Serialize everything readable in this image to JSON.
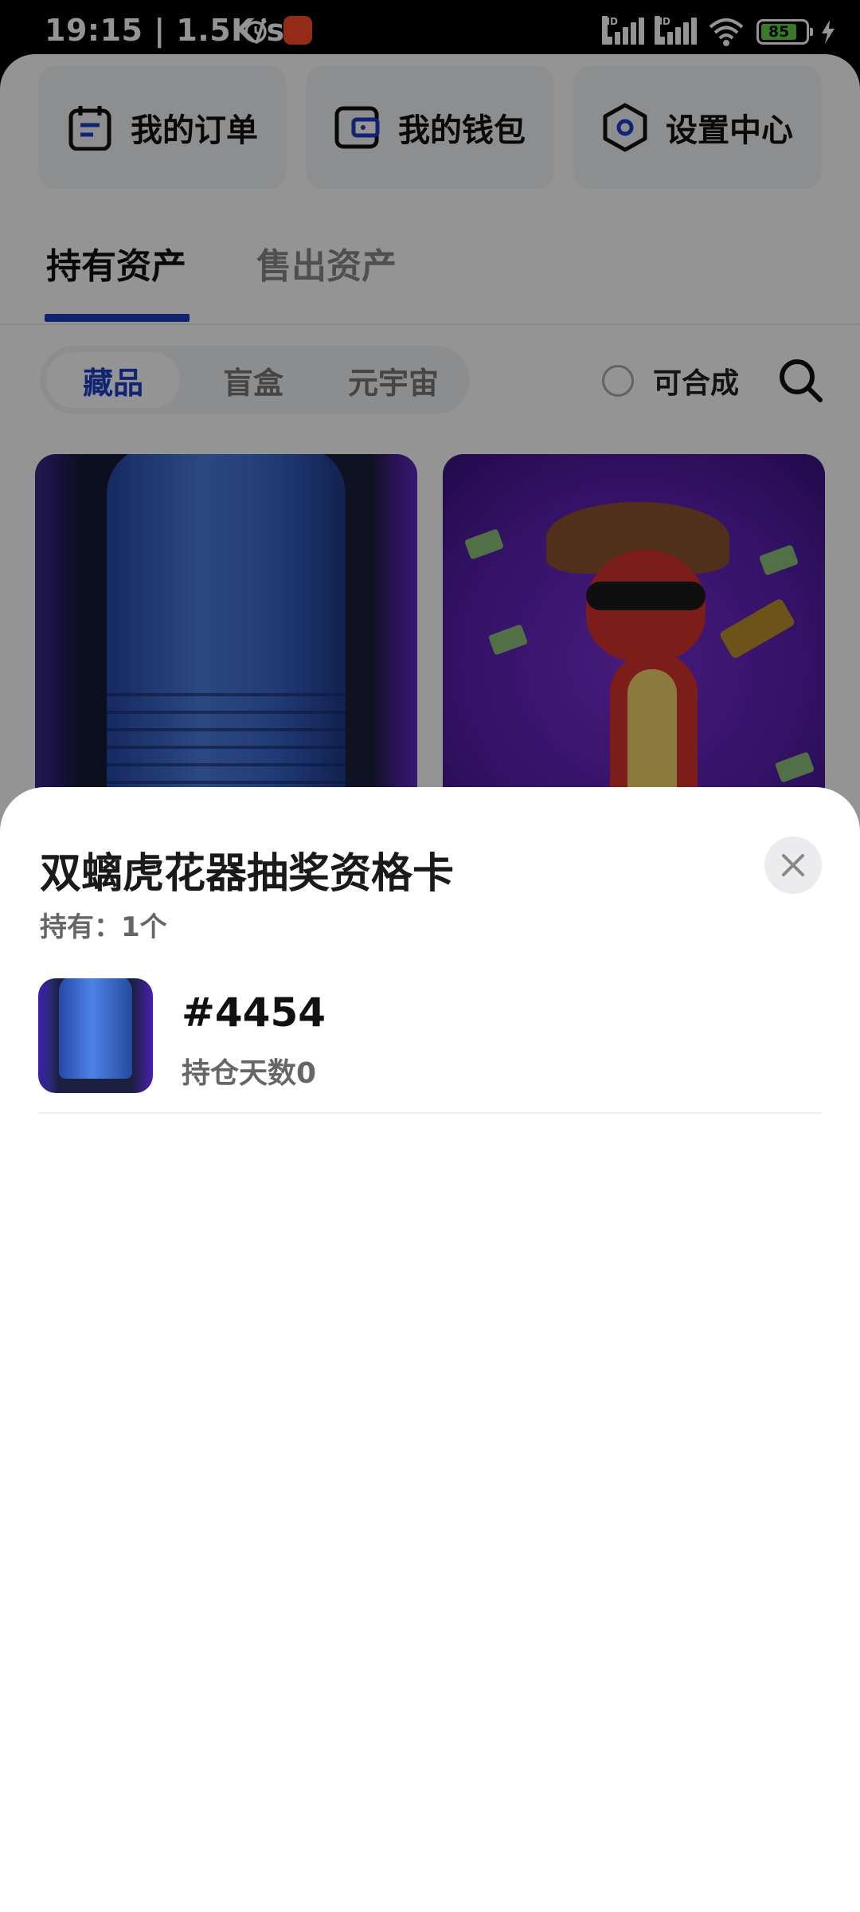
{
  "status_bar": {
    "time": "19:15",
    "speed": "1.5K/s",
    "battery": "85",
    "hd_label": "HD"
  },
  "quick_actions": {
    "orders_label": "我的订单",
    "wallet_label": "我的钱包",
    "settings_label": "设置中心"
  },
  "tabs": {
    "holding_label": "持有资产",
    "sold_label": "售出资产"
  },
  "filters": {
    "chips": [
      "藏品",
      "盲盒",
      "元宇宙"
    ],
    "synthesizable_label": "可合成"
  },
  "sheet": {
    "title": "双螭虎花器抽奖资格卡",
    "holding": "持有：1个",
    "items": [
      {
        "number": "#4454",
        "days": "持仓天数0"
      }
    ]
  },
  "colors": {
    "accent": "#1e3fc4",
    "battery": "#61d14b"
  }
}
